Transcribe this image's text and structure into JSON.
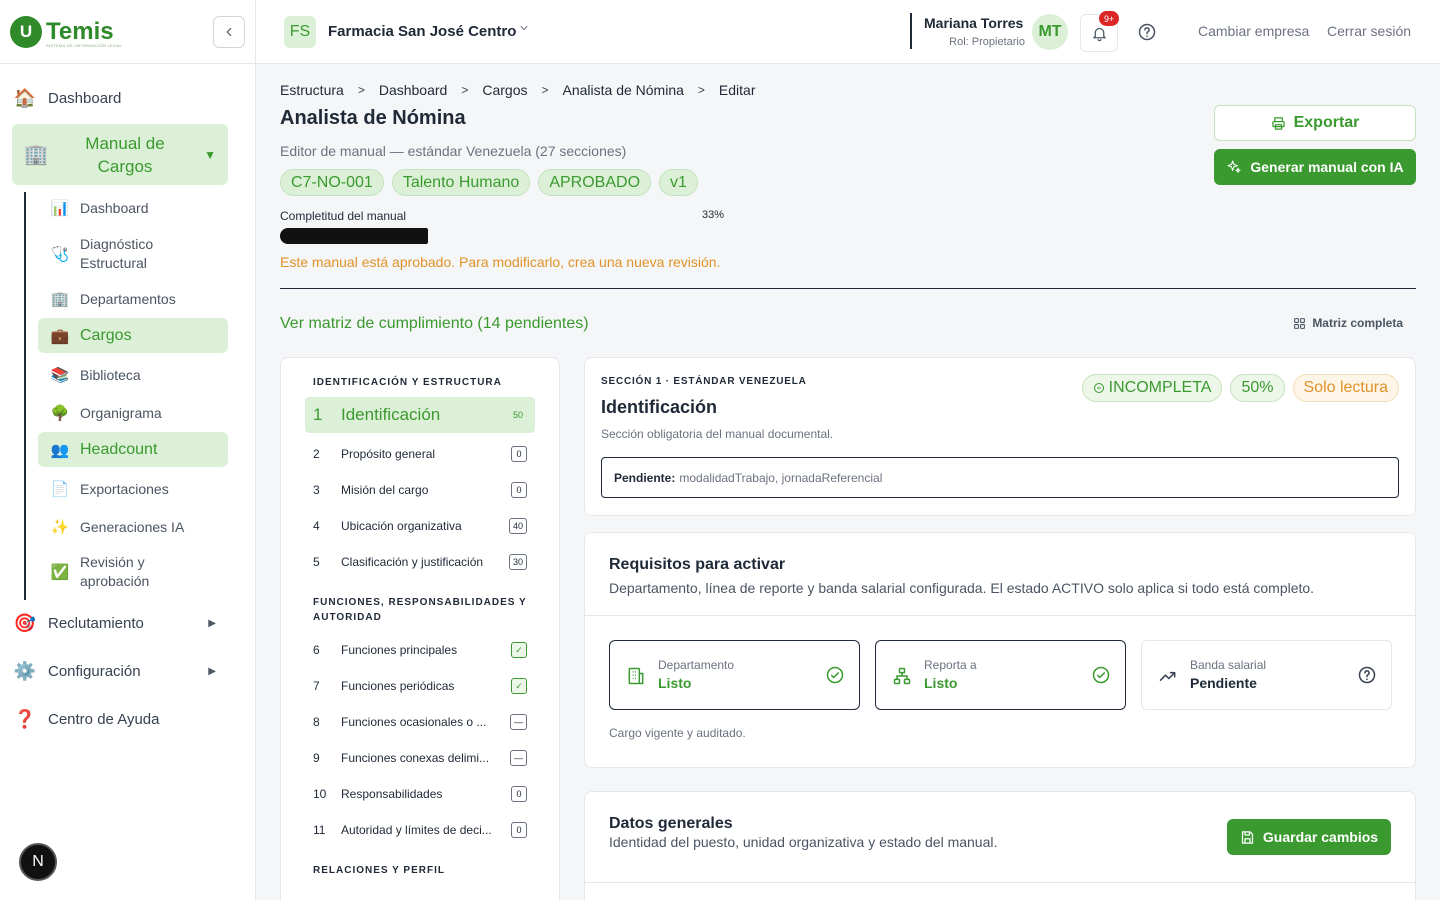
{
  "brand": {
    "name": "Temis",
    "logo_letter": "U",
    "tagline": "SISTEMA DE INFORMACIÓN LEGAL"
  },
  "sidebar": {
    "items": [
      {
        "label": "Dashboard",
        "icon": "house-icon"
      },
      {
        "label": "Manual de Cargos",
        "icon": "building-icon"
      },
      {
        "label": "Reclutamiento",
        "icon": "target-icon"
      },
      {
        "label": "Configuración",
        "icon": "gear-icon"
      },
      {
        "label": "Centro de Ayuda",
        "icon": "question-icon"
      }
    ],
    "subitems": [
      {
        "label": "Dashboard",
        "icon": "chart-icon"
      },
      {
        "label": "Diagnóstico Estructural",
        "icon": "stethoscope-icon"
      },
      {
        "label": "Departamentos",
        "icon": "building-icon"
      },
      {
        "label": "Cargos",
        "icon": "briefcase-icon"
      },
      {
        "label": "Biblioteca",
        "icon": "books-icon"
      },
      {
        "label": "Organigrama",
        "icon": "tree-icon"
      },
      {
        "label": "Headcount",
        "icon": "people-icon"
      },
      {
        "label": "Exportaciones",
        "icon": "document-icon"
      },
      {
        "label": "Generaciones IA",
        "icon": "sparkles-icon"
      },
      {
        "label": "Revisión y aprobación",
        "icon": "check-icon"
      }
    ],
    "bottom_badge": "N"
  },
  "topbar": {
    "company_initials": "FS",
    "company": "Farmacia San José Centro",
    "user_name": "Mariana Torres",
    "user_role": "Rol: Propietario",
    "user_initials": "MT",
    "notifications": "9+",
    "switch_company": "Cambiar empresa",
    "logout": "Cerrar sesión"
  },
  "breadcrumbs": [
    "Estructura",
    "Dashboard",
    "Cargos",
    "Analista de Nómina",
    "Editar"
  ],
  "page": {
    "title": "Analista de Nómina",
    "subtitle": "Editor de manual — estándar Venezuela (27 secciones)",
    "chips": [
      "C7-NO-001",
      "Talento Humano",
      "APROBADO",
      "v1"
    ],
    "progress_label": "Completitud del manual",
    "progress_text": "33%",
    "progress_value": 0.33,
    "warning": "Este manual está aprobado. Para modificarlo, crea una nueva revisión.",
    "matrix_link": "Ver matriz de cumplimiento (14 pendientes)",
    "matrix_full": "Matriz completa",
    "export_label": "Exportar",
    "generate_label": "Generar manual con IA"
  },
  "sections": {
    "group1": "IDENTIFICACIÓN Y ESTRUCTURA",
    "group2": "FUNCIONES, RESPONSABILIDADES Y AUTORIDAD",
    "group3": "RELACIONES Y PERFIL",
    "items": [
      {
        "num": "1",
        "name": "Identificación",
        "count": "50"
      },
      {
        "num": "2",
        "name": "Propósito general",
        "count": "0"
      },
      {
        "num": "3",
        "name": "Misión del cargo",
        "count": "0"
      },
      {
        "num": "4",
        "name": "Ubicación organizativa",
        "count": "40"
      },
      {
        "num": "5",
        "name": "Clasificación y justificación",
        "count": "30"
      },
      {
        "num": "6",
        "name": "Funciones principales",
        "count": "✓"
      },
      {
        "num": "7",
        "name": "Funciones periódicas",
        "count": "✓"
      },
      {
        "num": "8",
        "name": "Funciones ocasionales o ...",
        "count": "—"
      },
      {
        "num": "9",
        "name": "Funciones conexas delimi...",
        "count": "—"
      },
      {
        "num": "10",
        "name": "Responsabilidades",
        "count": "0"
      },
      {
        "num": "11",
        "name": "Autoridad y límites de deci...",
        "count": "0"
      }
    ]
  },
  "detail": {
    "kicker": "SECCIÓN 1 · ESTÁNDAR VENEZUELA",
    "title": "Identificación",
    "desc": "Sección obligatoria del manual documental.",
    "status": "INCOMPLETA",
    "percent": "50%",
    "mode": "Solo lectura",
    "pending_label": "Pendiente:",
    "pending_value": "modalidadTrabajo, jornadaReferencial"
  },
  "requirements": {
    "title": "Requisitos para activar",
    "desc": "Departamento, línea de reporte y banda salarial configurada. El estado ACTIVO solo aplica si todo está completo.",
    "boxes": [
      {
        "label": "Departamento",
        "value": "Listo"
      },
      {
        "label": "Reporta a",
        "value": "Listo"
      },
      {
        "label": "Banda salarial",
        "value": "Pendiente"
      }
    ],
    "footer": "Cargo vigente y auditado."
  },
  "general": {
    "title": "Datos generales",
    "desc": "Identidad del puesto, unidad organizativa y estado del manual.",
    "save_label": "Guardar cambios"
  },
  "colors": {
    "brand": "#3a9a2f",
    "brand_light": "#dcf0d7",
    "warning": "#e0922a",
    "danger": "#dc2626"
  }
}
